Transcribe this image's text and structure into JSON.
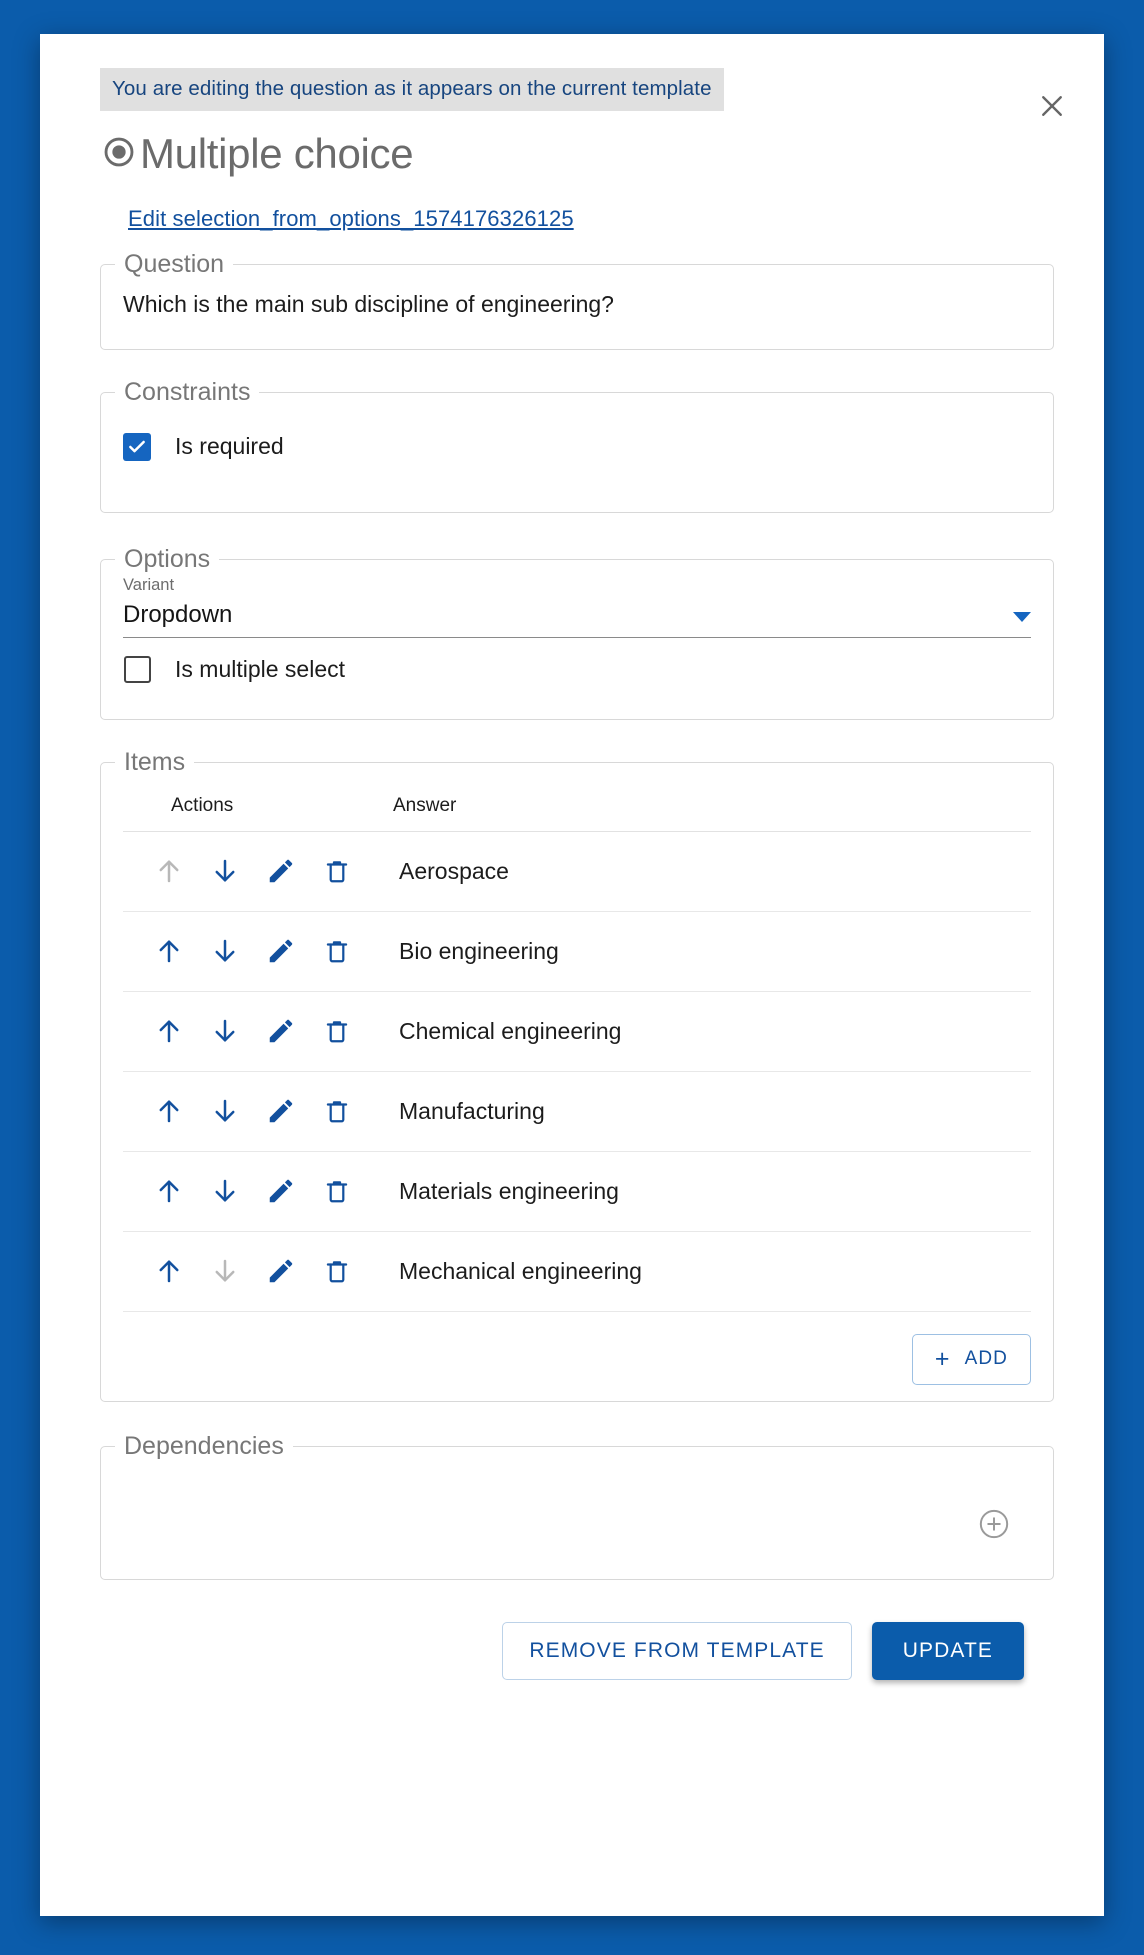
{
  "dialog": {
    "banner_text": "You are editing the question as it appears on the current template",
    "title": "Multiple choice",
    "title_icon": "radio-button-icon",
    "edit_link": "Edit selection_from_options_1574176326125",
    "close_icon": "close-icon"
  },
  "question": {
    "legend": "Question",
    "value": "Which is the main sub discipline of engineering?"
  },
  "constraints": {
    "legend": "Constraints",
    "is_required_label": "Is required",
    "is_required_checked": true
  },
  "options": {
    "legend": "Options",
    "variant_label": "Variant",
    "variant_value": "Dropdown",
    "variant_caret_icon": "chevron-down-icon",
    "is_multiple_select_label": "Is multiple select",
    "is_multiple_select_checked": false
  },
  "items": {
    "legend": "Items",
    "columns": [
      "Actions",
      "Answer"
    ],
    "rows": [
      {
        "answer": "Aerospace",
        "up_enabled": false,
        "down_enabled": true
      },
      {
        "answer": "Bio engineering",
        "up_enabled": true,
        "down_enabled": true
      },
      {
        "answer": "Chemical engineering",
        "up_enabled": true,
        "down_enabled": true
      },
      {
        "answer": "Manufacturing",
        "up_enabled": true,
        "down_enabled": true
      },
      {
        "answer": "Materials engineering",
        "up_enabled": true,
        "down_enabled": true
      },
      {
        "answer": "Mechanical engineering",
        "up_enabled": true,
        "down_enabled": false
      }
    ],
    "row_icons": [
      "arrow-up-icon",
      "arrow-down-icon",
      "pencil-edit-icon",
      "trash-delete-icon"
    ],
    "add_label": "ADD",
    "add_icon": "plus-icon"
  },
  "dependencies": {
    "legend": "Dependencies",
    "add_icon": "plus-circle-icon"
  },
  "footer": {
    "remove_label": "REMOVE FROM TEMPLATE",
    "update_label": "UPDATE"
  },
  "colors": {
    "backdrop_blue": "#0b5cab",
    "accent_blue": "#12509e",
    "checkbox_blue": "#1565c0",
    "banner_bg": "#e0e0e0",
    "disabled_grey": "#b8b8b8",
    "legend_grey": "#777777"
  }
}
